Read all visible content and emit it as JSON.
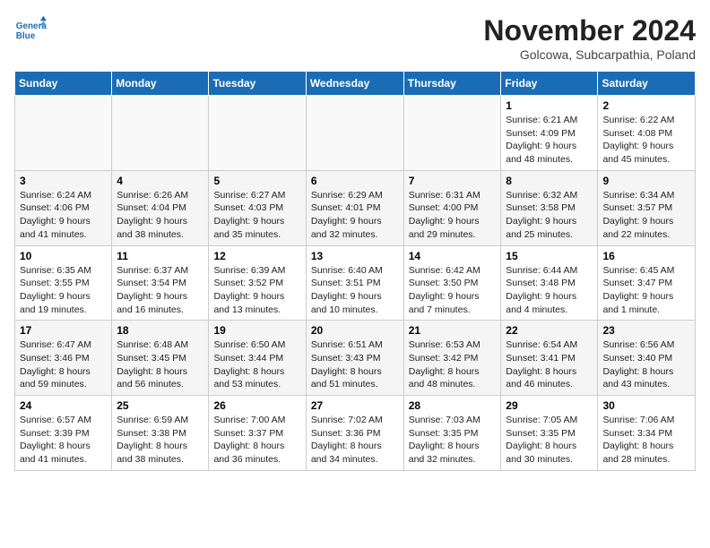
{
  "header": {
    "logo_line1": "General",
    "logo_line2": "Blue",
    "month_title": "November 2024",
    "subtitle": "Golcowa, Subcarpathia, Poland"
  },
  "weekdays": [
    "Sunday",
    "Monday",
    "Tuesday",
    "Wednesday",
    "Thursday",
    "Friday",
    "Saturday"
  ],
  "weeks": [
    [
      {
        "day": "",
        "info": ""
      },
      {
        "day": "",
        "info": ""
      },
      {
        "day": "",
        "info": ""
      },
      {
        "day": "",
        "info": ""
      },
      {
        "day": "",
        "info": ""
      },
      {
        "day": "1",
        "info": "Sunrise: 6:21 AM\nSunset: 4:09 PM\nDaylight: 9 hours and 48 minutes."
      },
      {
        "day": "2",
        "info": "Sunrise: 6:22 AM\nSunset: 4:08 PM\nDaylight: 9 hours and 45 minutes."
      }
    ],
    [
      {
        "day": "3",
        "info": "Sunrise: 6:24 AM\nSunset: 4:06 PM\nDaylight: 9 hours and 41 minutes."
      },
      {
        "day": "4",
        "info": "Sunrise: 6:26 AM\nSunset: 4:04 PM\nDaylight: 9 hours and 38 minutes."
      },
      {
        "day": "5",
        "info": "Sunrise: 6:27 AM\nSunset: 4:03 PM\nDaylight: 9 hours and 35 minutes."
      },
      {
        "day": "6",
        "info": "Sunrise: 6:29 AM\nSunset: 4:01 PM\nDaylight: 9 hours and 32 minutes."
      },
      {
        "day": "7",
        "info": "Sunrise: 6:31 AM\nSunset: 4:00 PM\nDaylight: 9 hours and 29 minutes."
      },
      {
        "day": "8",
        "info": "Sunrise: 6:32 AM\nSunset: 3:58 PM\nDaylight: 9 hours and 25 minutes."
      },
      {
        "day": "9",
        "info": "Sunrise: 6:34 AM\nSunset: 3:57 PM\nDaylight: 9 hours and 22 minutes."
      }
    ],
    [
      {
        "day": "10",
        "info": "Sunrise: 6:35 AM\nSunset: 3:55 PM\nDaylight: 9 hours and 19 minutes."
      },
      {
        "day": "11",
        "info": "Sunrise: 6:37 AM\nSunset: 3:54 PM\nDaylight: 9 hours and 16 minutes."
      },
      {
        "day": "12",
        "info": "Sunrise: 6:39 AM\nSunset: 3:52 PM\nDaylight: 9 hours and 13 minutes."
      },
      {
        "day": "13",
        "info": "Sunrise: 6:40 AM\nSunset: 3:51 PM\nDaylight: 9 hours and 10 minutes."
      },
      {
        "day": "14",
        "info": "Sunrise: 6:42 AM\nSunset: 3:50 PM\nDaylight: 9 hours and 7 minutes."
      },
      {
        "day": "15",
        "info": "Sunrise: 6:44 AM\nSunset: 3:48 PM\nDaylight: 9 hours and 4 minutes."
      },
      {
        "day": "16",
        "info": "Sunrise: 6:45 AM\nSunset: 3:47 PM\nDaylight: 9 hours and 1 minute."
      }
    ],
    [
      {
        "day": "17",
        "info": "Sunrise: 6:47 AM\nSunset: 3:46 PM\nDaylight: 8 hours and 59 minutes."
      },
      {
        "day": "18",
        "info": "Sunrise: 6:48 AM\nSunset: 3:45 PM\nDaylight: 8 hours and 56 minutes."
      },
      {
        "day": "19",
        "info": "Sunrise: 6:50 AM\nSunset: 3:44 PM\nDaylight: 8 hours and 53 minutes."
      },
      {
        "day": "20",
        "info": "Sunrise: 6:51 AM\nSunset: 3:43 PM\nDaylight: 8 hours and 51 minutes."
      },
      {
        "day": "21",
        "info": "Sunrise: 6:53 AM\nSunset: 3:42 PM\nDaylight: 8 hours and 48 minutes."
      },
      {
        "day": "22",
        "info": "Sunrise: 6:54 AM\nSunset: 3:41 PM\nDaylight: 8 hours and 46 minutes."
      },
      {
        "day": "23",
        "info": "Sunrise: 6:56 AM\nSunset: 3:40 PM\nDaylight: 8 hours and 43 minutes."
      }
    ],
    [
      {
        "day": "24",
        "info": "Sunrise: 6:57 AM\nSunset: 3:39 PM\nDaylight: 8 hours and 41 minutes."
      },
      {
        "day": "25",
        "info": "Sunrise: 6:59 AM\nSunset: 3:38 PM\nDaylight: 8 hours and 38 minutes."
      },
      {
        "day": "26",
        "info": "Sunrise: 7:00 AM\nSunset: 3:37 PM\nDaylight: 8 hours and 36 minutes."
      },
      {
        "day": "27",
        "info": "Sunrise: 7:02 AM\nSunset: 3:36 PM\nDaylight: 8 hours and 34 minutes."
      },
      {
        "day": "28",
        "info": "Sunrise: 7:03 AM\nSunset: 3:35 PM\nDaylight: 8 hours and 32 minutes."
      },
      {
        "day": "29",
        "info": "Sunrise: 7:05 AM\nSunset: 3:35 PM\nDaylight: 8 hours and 30 minutes."
      },
      {
        "day": "30",
        "info": "Sunrise: 7:06 AM\nSunset: 3:34 PM\nDaylight: 8 hours and 28 minutes."
      }
    ]
  ]
}
